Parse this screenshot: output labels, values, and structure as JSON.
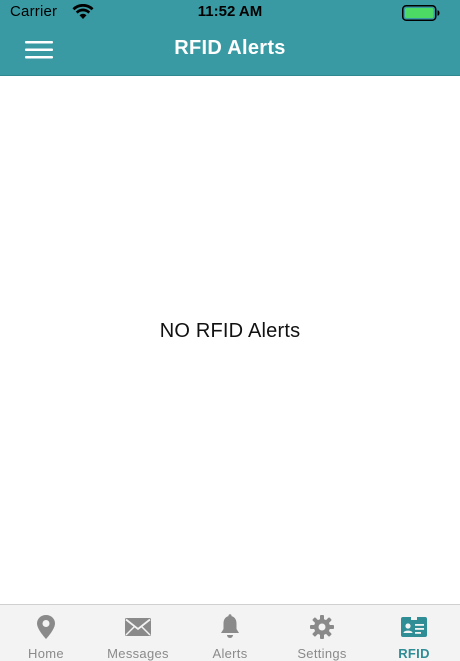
{
  "status_bar": {
    "carrier": "Carrier",
    "time": "11:52 AM"
  },
  "header": {
    "title": "RFID Alerts",
    "menu_icon": "hamburger-menu-icon"
  },
  "content": {
    "empty_message": "NO RFID Alerts"
  },
  "tab_bar": {
    "active_tab": "RFID",
    "tabs": [
      {
        "label": "Home",
        "icon": "location-pin-icon"
      },
      {
        "label": "Messages",
        "icon": "envelope-icon"
      },
      {
        "label": "Alerts",
        "icon": "bell-icon"
      },
      {
        "label": "Settings",
        "icon": "gear-icon"
      },
      {
        "label": "RFID",
        "icon": "id-card-icon"
      }
    ]
  },
  "colors": {
    "header": "#3a9aa3",
    "active_tab": "#2f8d96",
    "inactive_tab": "#8a8a8a",
    "battery": "#4cd964"
  }
}
